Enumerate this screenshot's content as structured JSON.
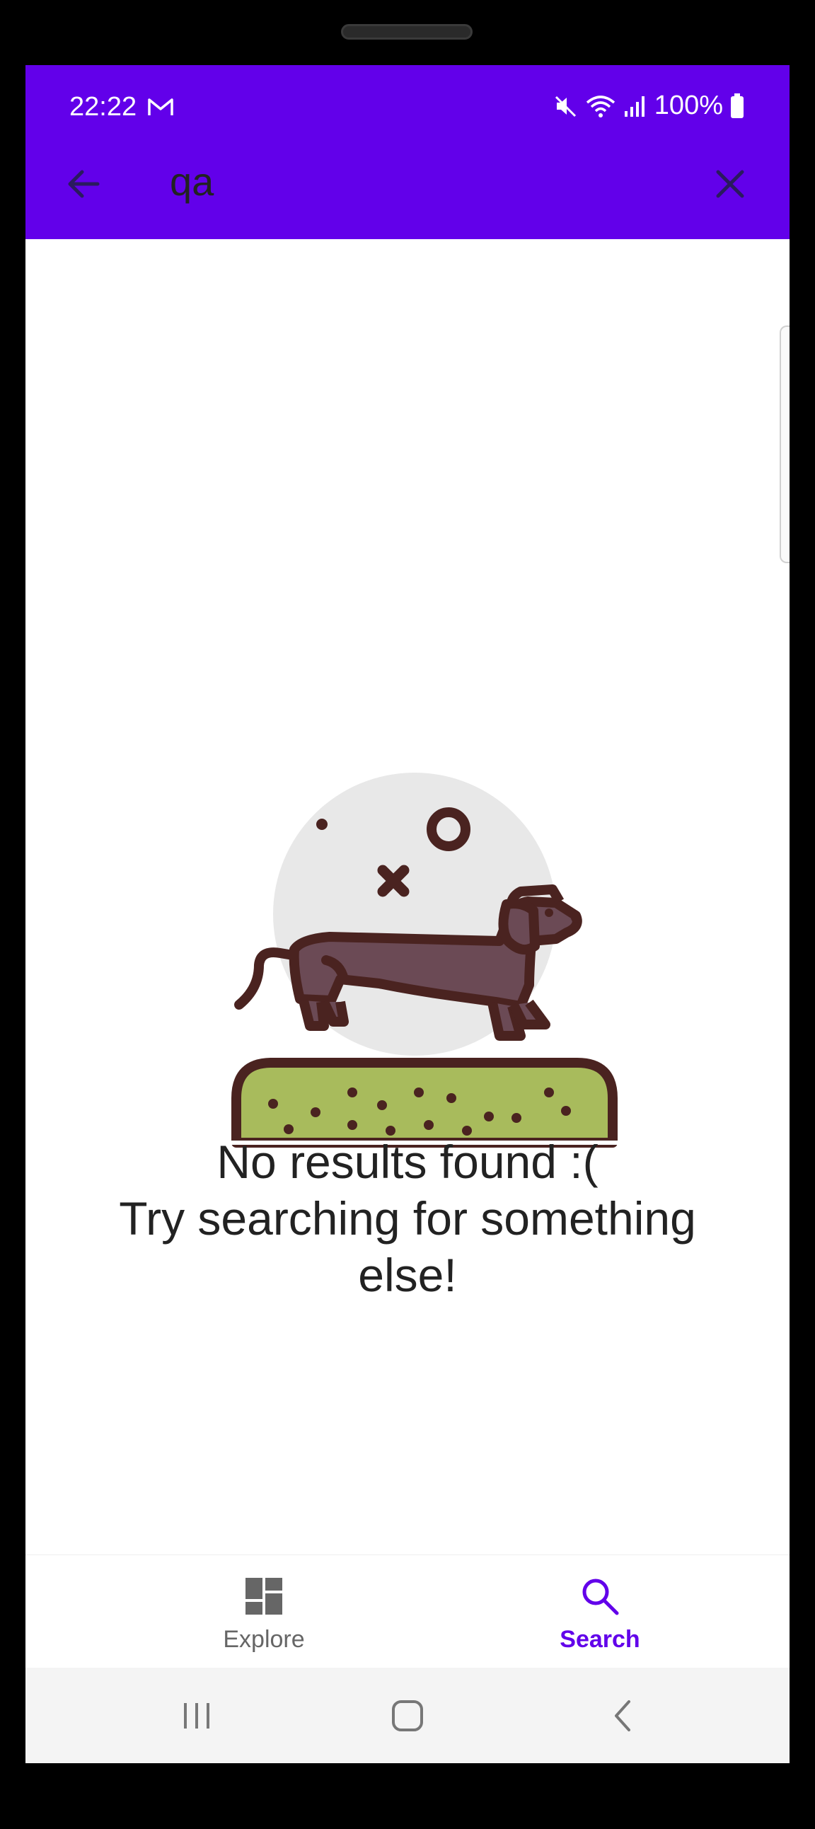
{
  "status_bar": {
    "time": "22:22",
    "battery": "100%",
    "icons": [
      "gmail-icon",
      "mute-icon",
      "wifi-icon",
      "signal-icon",
      "battery-icon"
    ]
  },
  "toolbar": {
    "back_icon": "arrow-left-icon",
    "search_query": "qa",
    "clear_icon": "close-icon",
    "background_color": "#6200ea"
  },
  "empty_state": {
    "illustration": "dachshund-illustration",
    "line1": "No results found :(",
    "line2": "Try searching for something",
    "line3": "else!"
  },
  "bottom_nav": {
    "items": [
      {
        "label": "Explore",
        "icon": "dashboard-icon",
        "active": false,
        "color": "#666666"
      },
      {
        "label": "Search",
        "icon": "search-icon",
        "active": true,
        "color": "#6200ea"
      }
    ]
  },
  "system_nav": {
    "icons": [
      "recent-apps-icon",
      "home-icon",
      "back-icon"
    ]
  }
}
